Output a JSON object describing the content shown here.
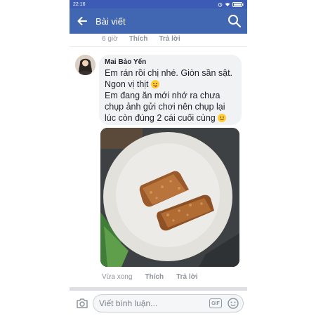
{
  "status": {
    "time": "22:16"
  },
  "appbar": {
    "title": "Bài viết"
  },
  "previous_comment": {
    "time": "6 giờ",
    "like_label": "Thích",
    "reply_label": "Trả lời"
  },
  "comment": {
    "author": "Mai Bảo Yến",
    "text": "Em rán rồi chị nhé. Giòn sần sật.\nNgon vị thịt",
    "text_line2": "Em đang ăn mới nhớ ra chưa chụp ảnh gửi chơi nên chụp lại lúc còn đúng 2 cái cuối cùng",
    "time": "Vừa xong",
    "like_label": "Thích",
    "reply_label": "Trả lời"
  },
  "composer": {
    "placeholder": "Viết bình luận...",
    "gif_label": "GIF"
  },
  "colors": {
    "brand": "#4267b2",
    "status_bar": "#3b5bb5",
    "bubble": "#f1f2f4",
    "muted": "#90949c"
  },
  "icons": [
    "back-arrow-icon",
    "search-icon",
    "camera-icon",
    "gif-icon",
    "smiley-icon",
    "alarm-icon",
    "wifi-icon",
    "battery-icon"
  ]
}
